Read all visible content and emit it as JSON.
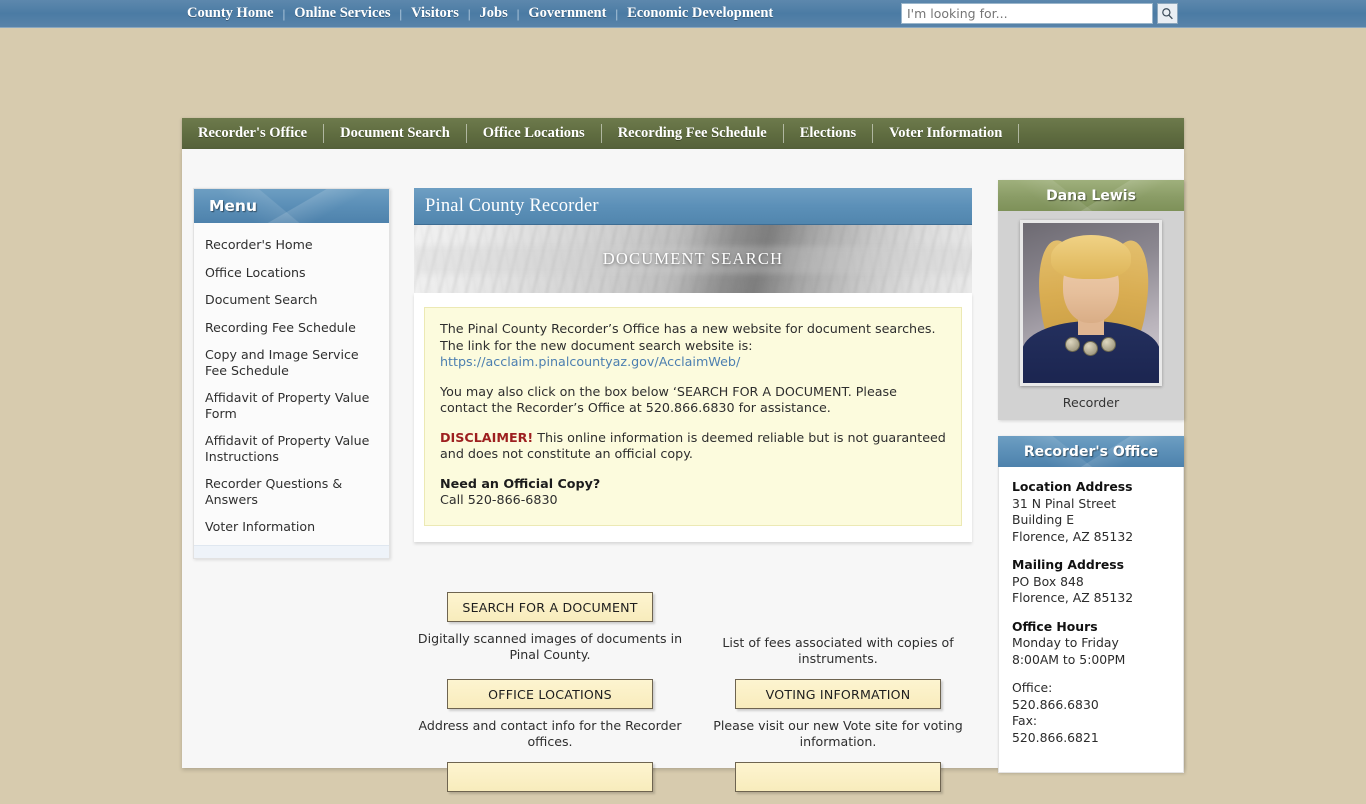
{
  "topbar": {
    "nav": [
      {
        "label": "County Home",
        "bold": true
      },
      {
        "label": "Online Services",
        "bold": true
      },
      {
        "label": "Visitors",
        "bold": true
      },
      {
        "label": "Jobs",
        "bold": true
      },
      {
        "label": "Government",
        "bold": true
      },
      {
        "label": "Economic Development",
        "bold": true
      }
    ],
    "separator": "|",
    "search_placeholder": "I'm looking for...",
    "search_value": "",
    "search_icon": "magnifier-icon"
  },
  "mainnav": {
    "items": [
      {
        "label": "Recorder's Office"
      },
      {
        "label": "Document Search"
      },
      {
        "label": "Office Locations"
      },
      {
        "label": "Recording Fee Schedule"
      },
      {
        "label": "Elections"
      },
      {
        "label": "Voter Information"
      }
    ]
  },
  "sidebar": {
    "title": "Menu",
    "items": [
      {
        "label": "Recorder's Home"
      },
      {
        "label": "Office Locations"
      },
      {
        "label": "Document Search"
      },
      {
        "label": "Recording Fee Schedule"
      },
      {
        "label": "Copy and Image Service Fee Schedule"
      },
      {
        "label": "Affidavit of Property Value Form"
      },
      {
        "label": "Affidavit of Property Value Instructions"
      },
      {
        "label": "Recorder Questions & Answers"
      },
      {
        "label": "Voter Information"
      }
    ]
  },
  "content": {
    "header_title": "Pinal County Recorder",
    "banner_title": "DOCUMENT SEARCH",
    "notice": {
      "para1_before_link": "The Pinal County Recorder’s Office has a new website for document searches. The link for the new document search website is:",
      "link_text": "https://acclaim.pinalcountyaz.gov/AcclaimWeb/",
      "para2": "You may also click on the box below ‘SEARCH FOR A DOCUMENT. Please contact the Recorder’s Office at 520.866.6830 for assistance.",
      "disclaimer_label": "DISCLAIMER!",
      "disclaimer_text": " This online information is deemed reliable but is not guaranteed and does not constitute an official copy.",
      "need_copy_heading": "Need an Official Copy?",
      "need_copy_text": "Call 520-866-6830"
    }
  },
  "buttons": [
    {
      "label": "SEARCH FOR A DOCUMENT",
      "caption": "Digitally scanned images of documents in Pinal County.",
      "has_button": true
    },
    {
      "label": "",
      "caption": "List of fees associated with copies of instruments.",
      "has_button": false
    },
    {
      "label": "OFFICE LOCATIONS",
      "caption": "Address and contact info for the Recorder offices.",
      "has_button": true
    },
    {
      "label": "VOTING INFORMATION",
      "caption": "Please visit our new Vote site for voting information.",
      "has_button": true
    },
    {
      "label": "",
      "caption": "",
      "has_button": true
    },
    {
      "label": "",
      "caption": "",
      "has_button": true
    }
  ],
  "recorder_card": {
    "name": "Dana Lewis",
    "photo_alt": "recorder-portrait",
    "caption": "Recorder"
  },
  "office_card": {
    "title": "Recorder's Office",
    "location_label": "Location Address",
    "location_line1": "31 N Pinal Street",
    "location_line2": "Building E",
    "location_line3": "Florence, AZ 85132",
    "mailing_label": "Mailing Address",
    "mailing_line1": "PO Box 848",
    "mailing_line2": "Florence, AZ 85132",
    "hours_label": "Office Hours",
    "hours_line1": "Monday to Friday",
    "hours_line2": "8:00AM to 5:00PM",
    "office_label": "Office:",
    "office_phone": "520.866.6830",
    "fax_label": "Fax:",
    "fax_phone": "520.866.6821"
  },
  "colors": {
    "page_bg": "#d7cbae",
    "topbar_blue": "#5883a9",
    "nav_green": "#5f6c40",
    "header_blue": "#5c90b8",
    "notice_yellow": "#fcfbdd",
    "button_yellow": "#f8ecbc",
    "disclaimer_red": "#9d1f1f",
    "link_blue": "#4c7fb0",
    "card_green": "#8a9c66"
  }
}
